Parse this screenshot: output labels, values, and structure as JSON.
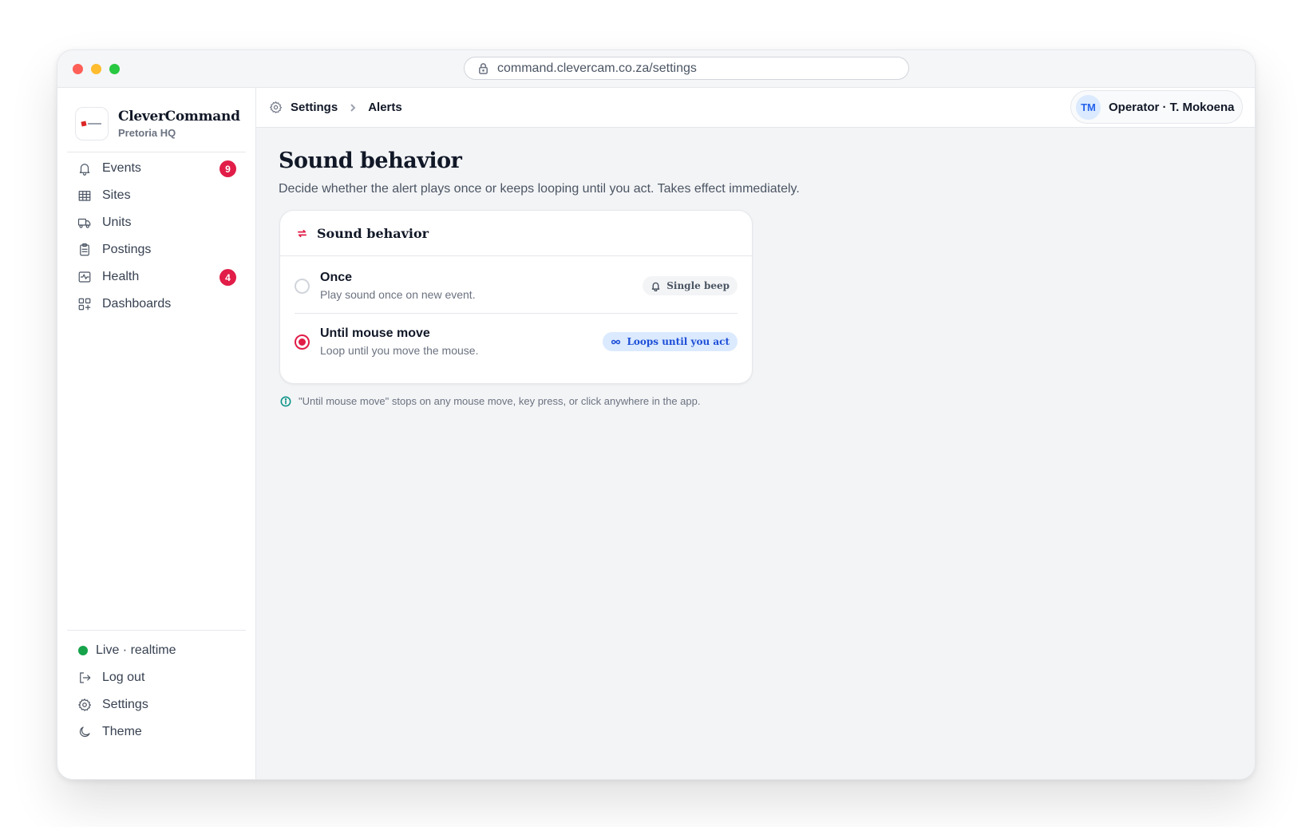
{
  "browser": {
    "url": "command.clevercam.co.za/settings"
  },
  "brand": {
    "name": "CleverCommand",
    "location": "Pretoria HQ"
  },
  "sidebar": {
    "items": [
      {
        "label": "Events",
        "icon": "bell-icon",
        "badge": "9"
      },
      {
        "label": "Sites",
        "icon": "building-icon"
      },
      {
        "label": "Units",
        "icon": "truck-icon"
      },
      {
        "label": "Postings",
        "icon": "clipboard-icon"
      },
      {
        "label": "Health",
        "icon": "activity-icon",
        "badge": "4"
      },
      {
        "label": "Dashboards",
        "icon": "grid-plus-icon"
      }
    ],
    "footer": {
      "status": "Live · realtime",
      "logout": "Log out",
      "settings": "Settings",
      "theme": "Theme"
    }
  },
  "breadcrumb": {
    "root": "Settings",
    "current": "Alerts"
  },
  "user": {
    "initials": "TM",
    "label": "Operator · T. Mokoena"
  },
  "page": {
    "title": "Sound behavior",
    "description": "Decide whether the alert plays once or keeps looping until you act. Takes effect immediately."
  },
  "card": {
    "title": "Sound behavior",
    "options": [
      {
        "label": "Once",
        "description": "Play sound once on new event.",
        "tag": "Single beep",
        "selected": false
      },
      {
        "label": "Until mouse move",
        "description": "Loop until you move the mouse.",
        "tag": "Loops until you act",
        "selected": true
      }
    ]
  },
  "hint": "\"Until mouse move\" stops on any mouse move, key press, or click anywhere in the app.",
  "colors": {
    "accent": "#e11d48",
    "live": "#16a34a",
    "info": "#1d4ed8"
  }
}
